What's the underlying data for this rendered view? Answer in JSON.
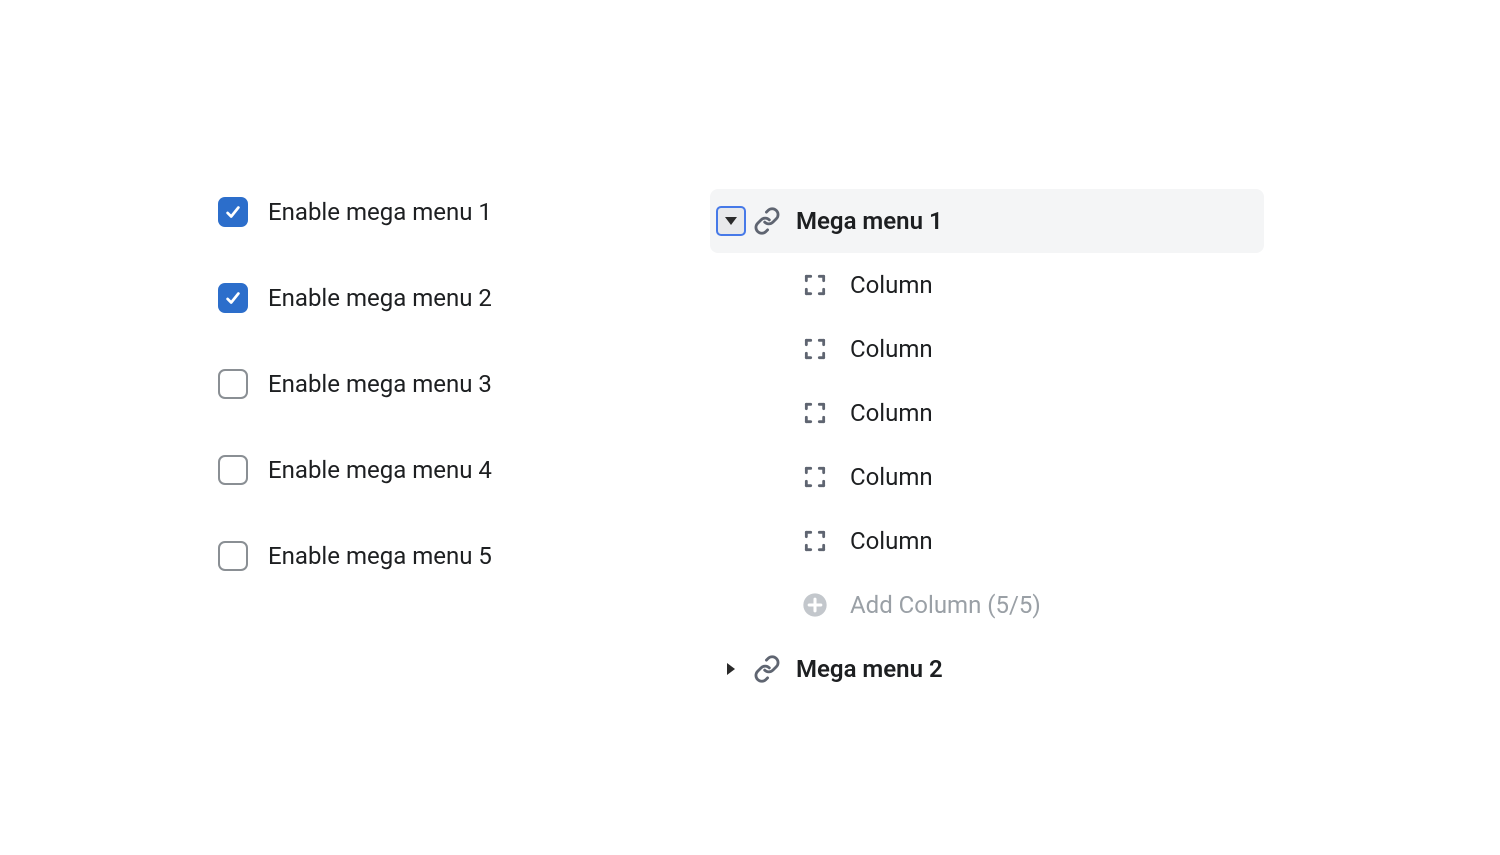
{
  "checkboxes": [
    {
      "label": "Enable mega menu 1",
      "checked": true
    },
    {
      "label": "Enable mega menu 2",
      "checked": true
    },
    {
      "label": "Enable mega menu 3",
      "checked": false
    },
    {
      "label": "Enable mega menu 4",
      "checked": false
    },
    {
      "label": "Enable mega menu 5",
      "checked": false
    }
  ],
  "tree": {
    "menu1": {
      "label": "Mega menu 1",
      "expanded": true,
      "selected": true,
      "children": [
        {
          "label": "Column"
        },
        {
          "label": "Column"
        },
        {
          "label": "Column"
        },
        {
          "label": "Column"
        },
        {
          "label": "Column"
        }
      ],
      "add_label": "Add Column (5/5)",
      "add_disabled": true
    },
    "menu2": {
      "label": "Mega menu 2",
      "expanded": false,
      "selected": false
    }
  },
  "colors": {
    "accent": "#2c6ecb",
    "focus_ring": "#4679e8",
    "selected_bg": "#f4f5f6",
    "disabled_text": "#9aa0a6",
    "icon_gray": "#5f6571"
  }
}
